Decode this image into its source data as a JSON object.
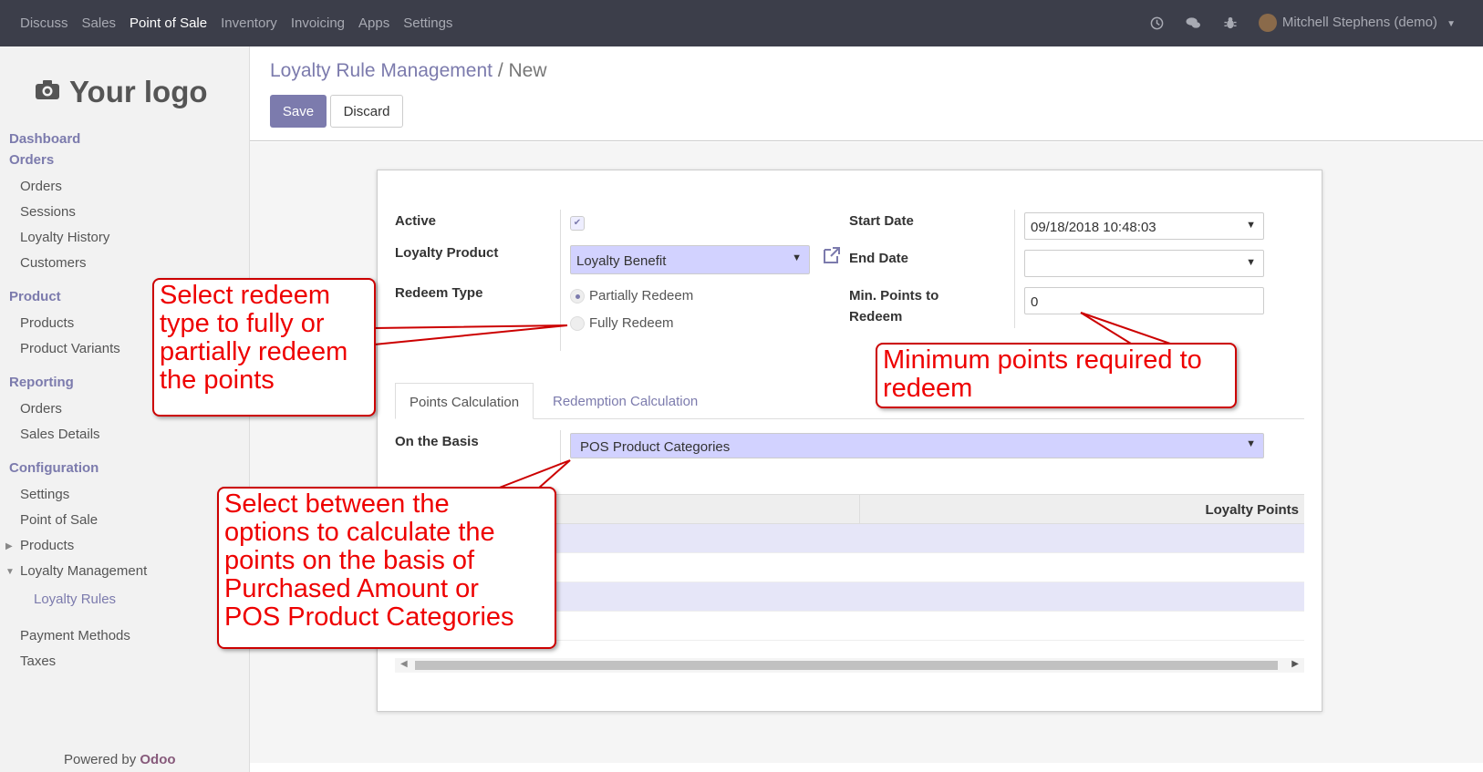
{
  "topbar": {
    "nav": [
      "Discuss",
      "Sales",
      "Point of Sale",
      "Inventory",
      "Invoicing",
      "Apps",
      "Settings"
    ],
    "active_nav": "Point of Sale",
    "user": "Mitchell Stephens (demo)",
    "icons": [
      "clock-icon",
      "chat-icon",
      "bug-icon"
    ]
  },
  "sidebar": {
    "logo_text": "Your logo",
    "sections": [
      {
        "title": "Dashboard"
      },
      {
        "title": "Orders",
        "items": [
          "Orders",
          "Sessions",
          "Loyalty History",
          "Customers"
        ]
      },
      {
        "title": "Product",
        "items": [
          "Products",
          "Product Variants"
        ]
      },
      {
        "title": "Reporting",
        "items": [
          "Orders",
          "Sales Details"
        ]
      },
      {
        "title": "Configuration",
        "items": [
          "Settings",
          "Point of Sale",
          "Products",
          "Loyalty Management",
          "Loyalty Rules",
          "Payment Methods",
          "Taxes"
        ]
      }
    ],
    "powered_by": "Powered by",
    "powered_brand": "Odoo"
  },
  "control_panel": {
    "breadcrumb_link": "Loyalty Rule Management",
    "breadcrumb_sep": "/",
    "breadcrumb_current": "New",
    "save_label": "Save",
    "discard_label": "Discard"
  },
  "form": {
    "active_label": "Active",
    "active_checked": true,
    "loyalty_product_label": "Loyalty Product",
    "loyalty_product_value": "Loyalty Benefit",
    "redeem_type_label": "Redeem Type",
    "redeem_options": [
      "Partially Redeem",
      "Fully Redeem"
    ],
    "redeem_selected": "Partially Redeem",
    "start_date_label": "Start Date",
    "start_date_value": "09/18/2018 10:48:03",
    "end_date_label": "End Date",
    "end_date_value": "",
    "min_points_label_1": "Min. Points to",
    "min_points_label_2": "Redeem",
    "min_points_value": "0",
    "tabs": [
      "Points Calculation",
      "Redemption Calculation"
    ],
    "active_tab": "Points Calculation",
    "basis_label": "On the Basis",
    "basis_value": "POS Product Categories",
    "table_header": "Loyalty Points"
  },
  "callouts": {
    "redeem_type": [
      "Select redeem",
      "type to fully or",
      "partially redeem",
      "the points"
    ],
    "min_points": [
      "Minimum points required to",
      "redeem"
    ],
    "basis": [
      "Select between the",
      "options to calculate the",
      "points on the basis of",
      "Purchased Amount or",
      "POS Product Categories"
    ]
  },
  "colors": {
    "topbar_bg": "#3c3e4a",
    "accent": "#7c7bad",
    "required_field_bg": "#d2d2ff",
    "callout_red": "#e00000"
  }
}
